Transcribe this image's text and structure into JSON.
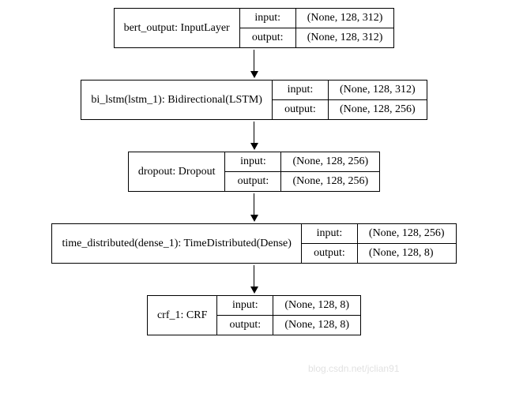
{
  "labels": {
    "input": "input:",
    "output": "output:"
  },
  "watermark": "blog.csdn.net/jclian91",
  "layers": [
    {
      "name": "bert_output: InputLayer",
      "input_shape": "(None, 128, 312)",
      "output_shape": "(None, 128, 312)"
    },
    {
      "name": "bi_lstm(lstm_1): Bidirectional(LSTM)",
      "input_shape": "(None, 128, 312)",
      "output_shape": "(None, 128, 256)"
    },
    {
      "name": "dropout: Dropout",
      "input_shape": "(None, 128, 256)",
      "output_shape": "(None, 128, 256)"
    },
    {
      "name": "time_distributed(dense_1): TimeDistributed(Dense)",
      "input_shape": "(None, 128, 256)",
      "output_shape": "(None, 128, 8)"
    },
    {
      "name": "crf_1: CRF",
      "input_shape": "(None, 128, 8)",
      "output_shape": "(None, 128, 8)"
    }
  ]
}
